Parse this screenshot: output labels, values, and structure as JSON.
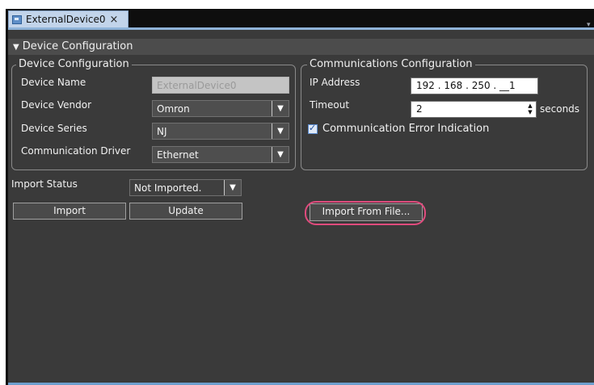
{
  "tab": {
    "title": "ExternalDevice0",
    "close": "×",
    "overflow": "▾"
  },
  "header": {
    "toggle": "▼",
    "title": "Device Configuration"
  },
  "device_config": {
    "legend": "Device Configuration",
    "name_label": "Device Name",
    "name_value": "ExternalDevice0",
    "vendor_label": "Device Vendor",
    "vendor_value": "Omron",
    "series_label": "Device Series",
    "series_value": "NJ",
    "driver_label": "Communication Driver",
    "driver_value": "Ethernet"
  },
  "comm_config": {
    "legend": "Communications Configuration",
    "ip_label": "IP Address",
    "ip_value": "192 . 168 . 250 . __1",
    "timeout_label": "Timeout",
    "timeout_value": "2",
    "timeout_unit": "seconds",
    "error_indication_label": "Communication Error Indication",
    "error_indication_checked": true
  },
  "import": {
    "status_label": "Import Status",
    "status_value": "Not Imported.",
    "import_button": "Import",
    "update_button": "Update",
    "import_file_button": "Import From File..."
  },
  "icons": {
    "dropdown": "▼",
    "spin_up": "▲",
    "spin_down": "▼"
  },
  "colors": {
    "panel_bg": "#3a3a3a",
    "highlight": "#e04b7d",
    "tab_bg": "#c2d4ea",
    "accent_line": "#6d9fce"
  }
}
